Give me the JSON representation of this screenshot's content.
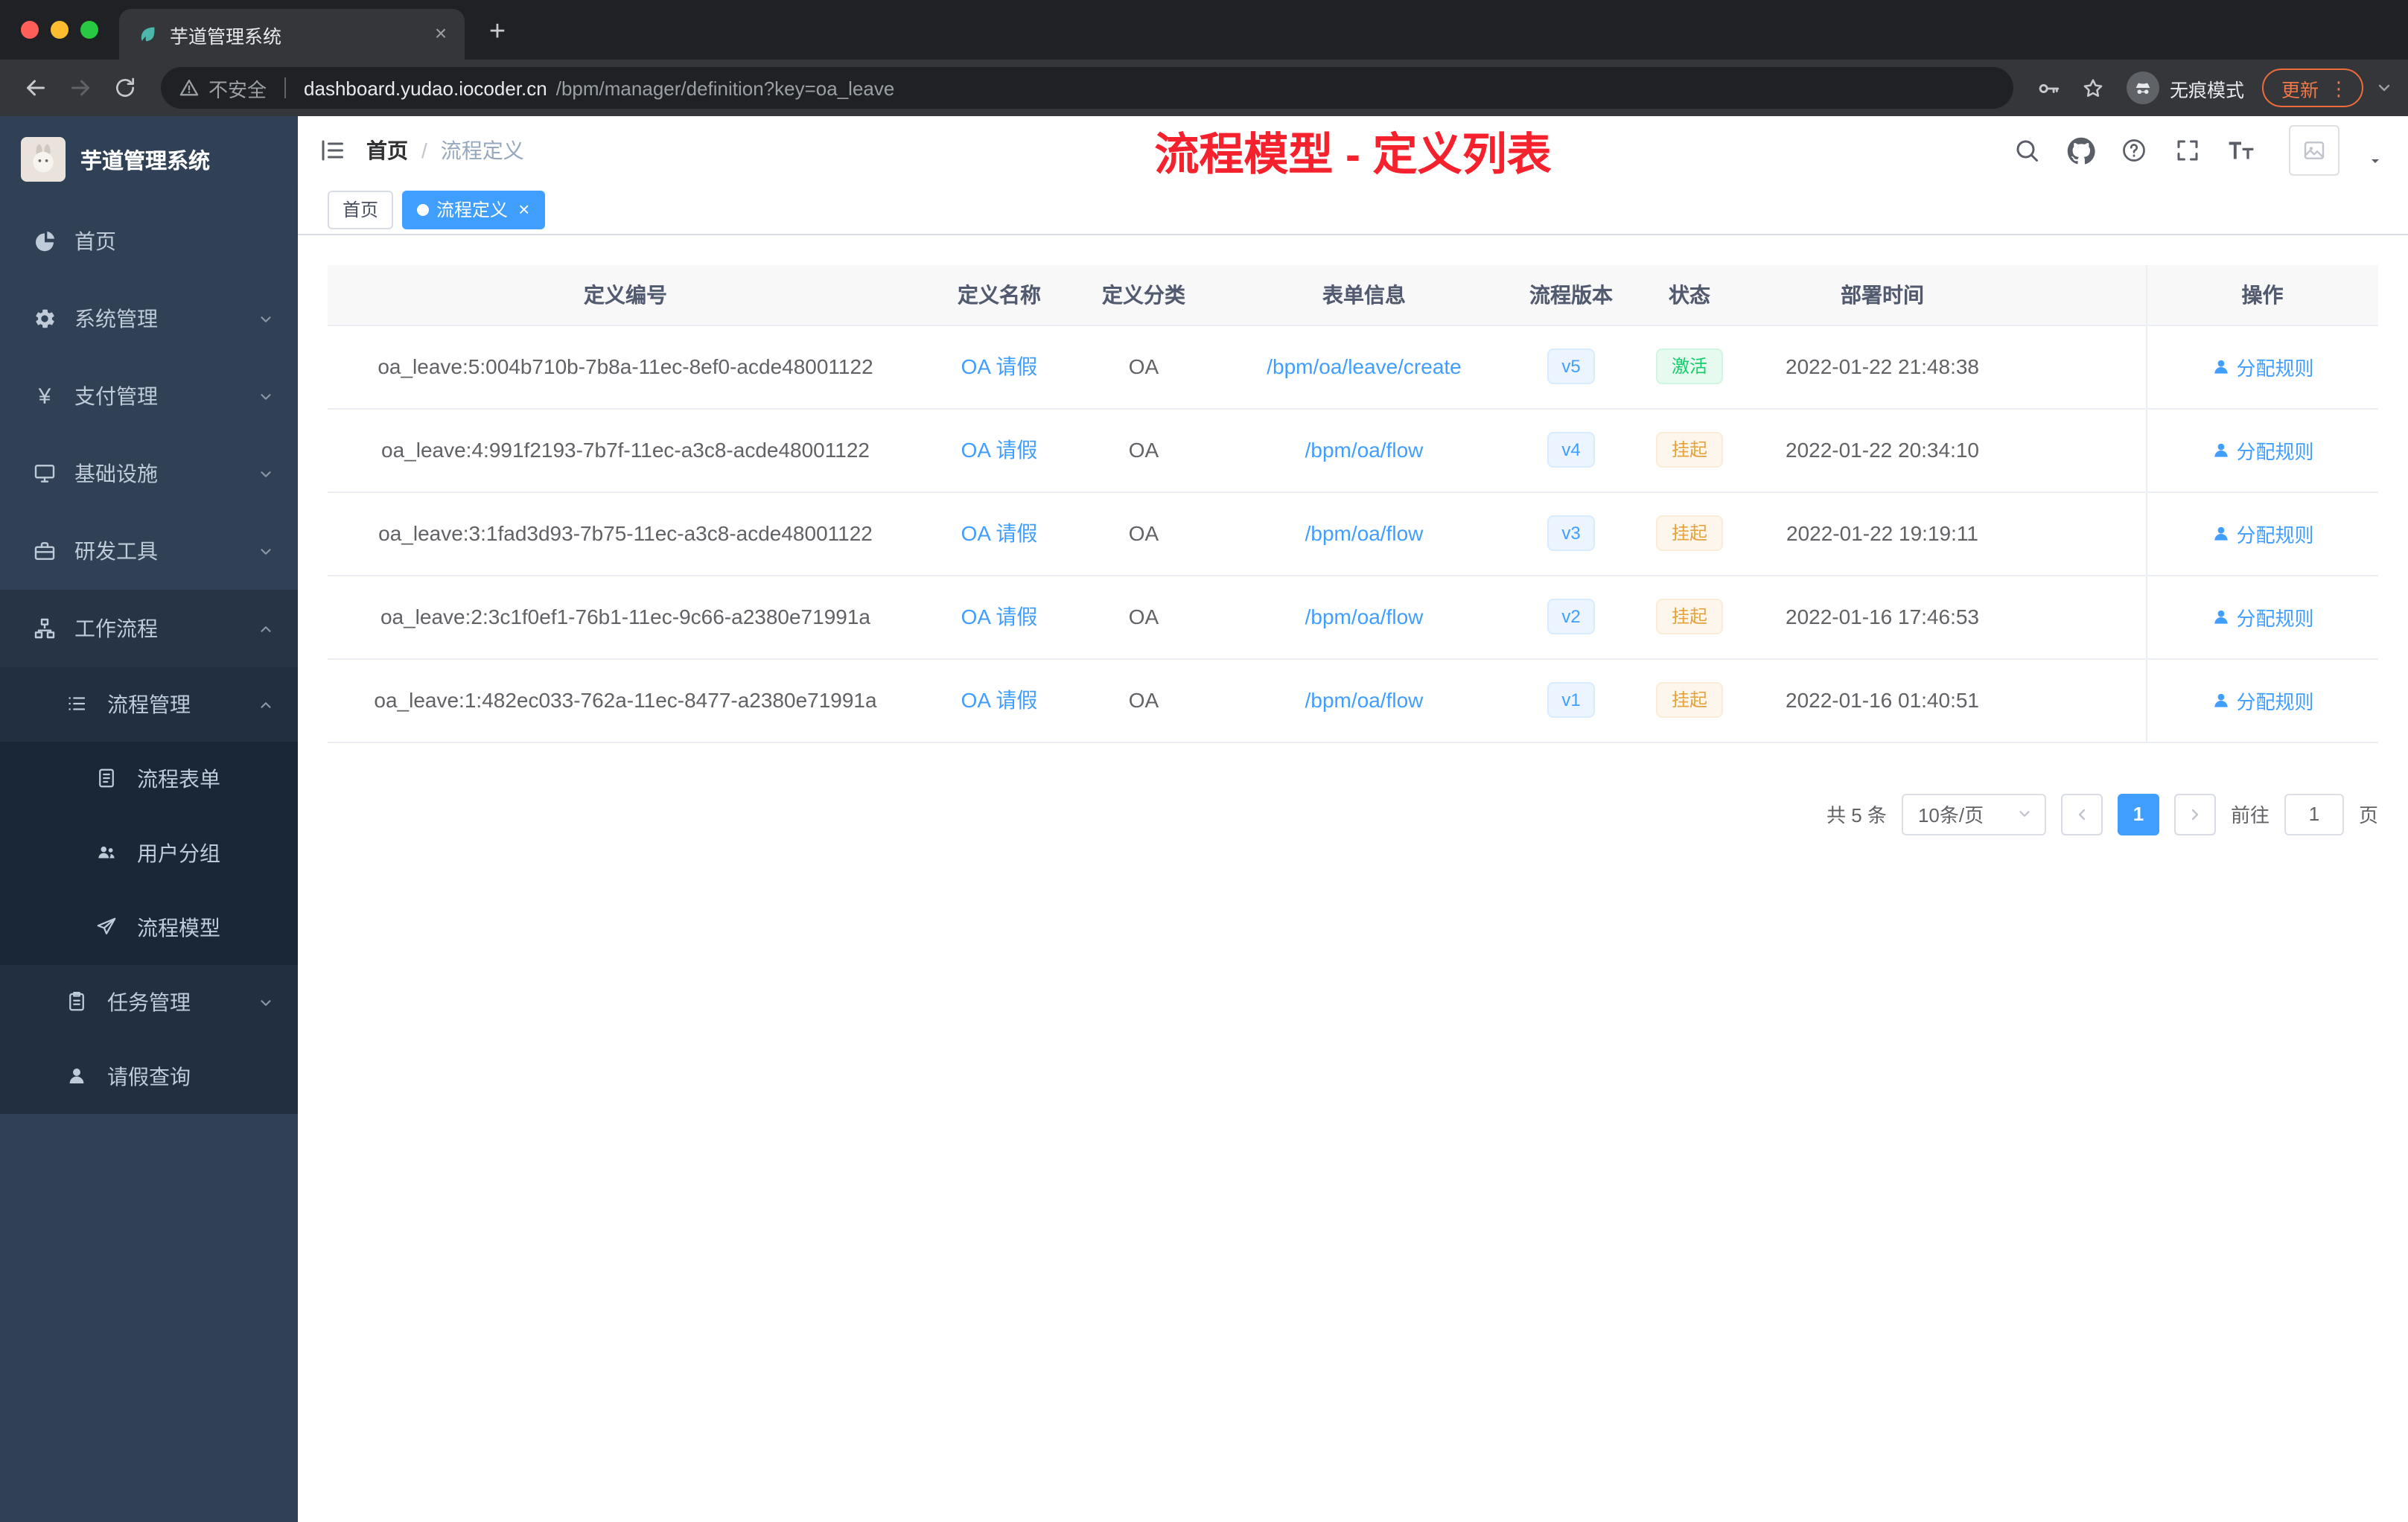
{
  "colors": {
    "accent": "#409eff",
    "success": "#13ce66",
    "warning": "#e6a23c",
    "annotation_red": "#f5222d",
    "sidebar_bg": "#304156",
    "browser_dark": "#202124",
    "toolbar_dark": "#35363a"
  },
  "browser": {
    "tab_title": "芋道管理系统",
    "security_label": "不安全",
    "url_domain": "dashboard.yudao.iocoder.cn",
    "url_path": "/bpm/manager/definition?key=oa_leave",
    "incognito_label": "无痕模式",
    "update_label": "更新"
  },
  "sidebar": {
    "logo_title": "芋道管理系统",
    "items": [
      {
        "label": "首页"
      },
      {
        "label": "系统管理"
      },
      {
        "label": "支付管理"
      },
      {
        "label": "基础设施"
      },
      {
        "label": "研发工具"
      },
      {
        "label": "工作流程"
      }
    ],
    "workflow": {
      "process_mgmt": "流程管理",
      "children": [
        {
          "label": "流程表单"
        },
        {
          "label": "用户分组"
        },
        {
          "label": "流程模型"
        }
      ],
      "task_mgmt": "任务管理",
      "leave_query": "请假查询"
    }
  },
  "header": {
    "breadcrumb_home": "首页",
    "breadcrumb_sep": "/",
    "breadcrumb_current": "流程定义",
    "annotation": "流程模型 - 定义列表"
  },
  "tags": {
    "home": "首页",
    "active": "流程定义"
  },
  "table": {
    "columns": [
      "定义编号",
      "定义名称",
      "定义分类",
      "表单信息",
      "流程版本",
      "状态",
      "部署时间",
      "操作"
    ],
    "rows": [
      {
        "id": "oa_leave:5:004b710b-7b8a-11ec-8ef0-acde48001122",
        "name": "OA 请假",
        "category": "OA",
        "form": "/bpm/oa/leave/create",
        "version": "v5",
        "status": "激活",
        "status_type": "success",
        "deployed": "2022-01-22 21:48:38",
        "action": "分配规则"
      },
      {
        "id": "oa_leave:4:991f2193-7b7f-11ec-a3c8-acde48001122",
        "name": "OA 请假",
        "category": "OA",
        "form": "/bpm/oa/flow",
        "version": "v4",
        "status": "挂起",
        "status_type": "warning",
        "deployed": "2022-01-22 20:34:10",
        "action": "分配规则"
      },
      {
        "id": "oa_leave:3:1fad3d93-7b75-11ec-a3c8-acde48001122",
        "name": "OA 请假",
        "category": "OA",
        "form": "/bpm/oa/flow",
        "version": "v3",
        "status": "挂起",
        "status_type": "warning",
        "deployed": "2022-01-22 19:19:11",
        "action": "分配规则"
      },
      {
        "id": "oa_leave:2:3c1f0ef1-76b1-11ec-9c66-a2380e71991a",
        "name": "OA 请假",
        "category": "OA",
        "form": "/bpm/oa/flow",
        "version": "v2",
        "status": "挂起",
        "status_type": "warning",
        "deployed": "2022-01-16 17:46:53",
        "action": "分配规则"
      },
      {
        "id": "oa_leave:1:482ec033-762a-11ec-8477-a2380e71991a",
        "name": "OA 请假",
        "category": "OA",
        "form": "/bpm/oa/flow",
        "version": "v1",
        "status": "挂起",
        "status_type": "warning",
        "deployed": "2022-01-16 01:40:51",
        "action": "分配规则"
      }
    ]
  },
  "pagination": {
    "total": "共 5 条",
    "page_size": "10条/页",
    "page": "1",
    "goto_label": "前往",
    "goto_value": "1",
    "page_unit": "页"
  }
}
